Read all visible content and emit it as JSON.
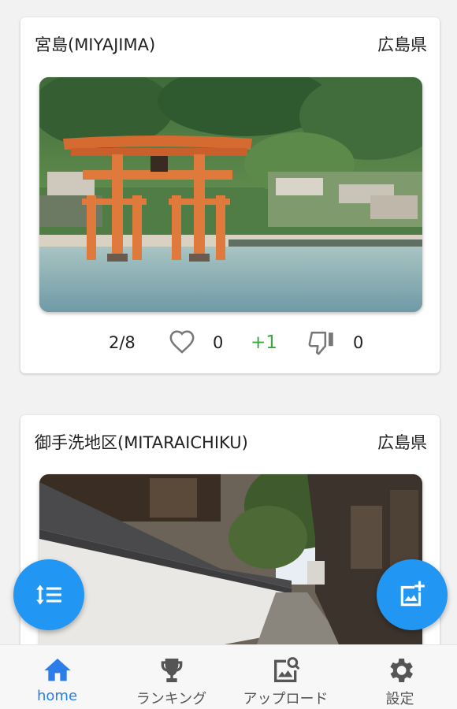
{
  "colors": {
    "accent": "#2196f3",
    "active_nav": "#2b7de9",
    "plus_vote": "#3aa83a"
  },
  "posts": [
    {
      "title": "宮島(MIYAJIMA)",
      "prefecture": "広島県",
      "photo_subject": "torii-gate",
      "page": "2/8",
      "likes": "0",
      "vote_delta": "+1",
      "dislikes": "0"
    },
    {
      "title": "御手洗地区(MITARAICHIKU)",
      "prefecture": "広島県",
      "photo_subject": "old-street"
    }
  ],
  "fab": {
    "sort_icon": "sort-icon",
    "add_photo_icon": "add-photo-icon"
  },
  "nav": [
    {
      "label": "home",
      "icon": "home-icon",
      "active": true
    },
    {
      "label": "ランキング",
      "icon": "trophy-icon",
      "active": false
    },
    {
      "label": "アップロード",
      "icon": "upload-image-icon",
      "active": false
    },
    {
      "label": "設定",
      "icon": "gear-icon",
      "active": false
    }
  ]
}
